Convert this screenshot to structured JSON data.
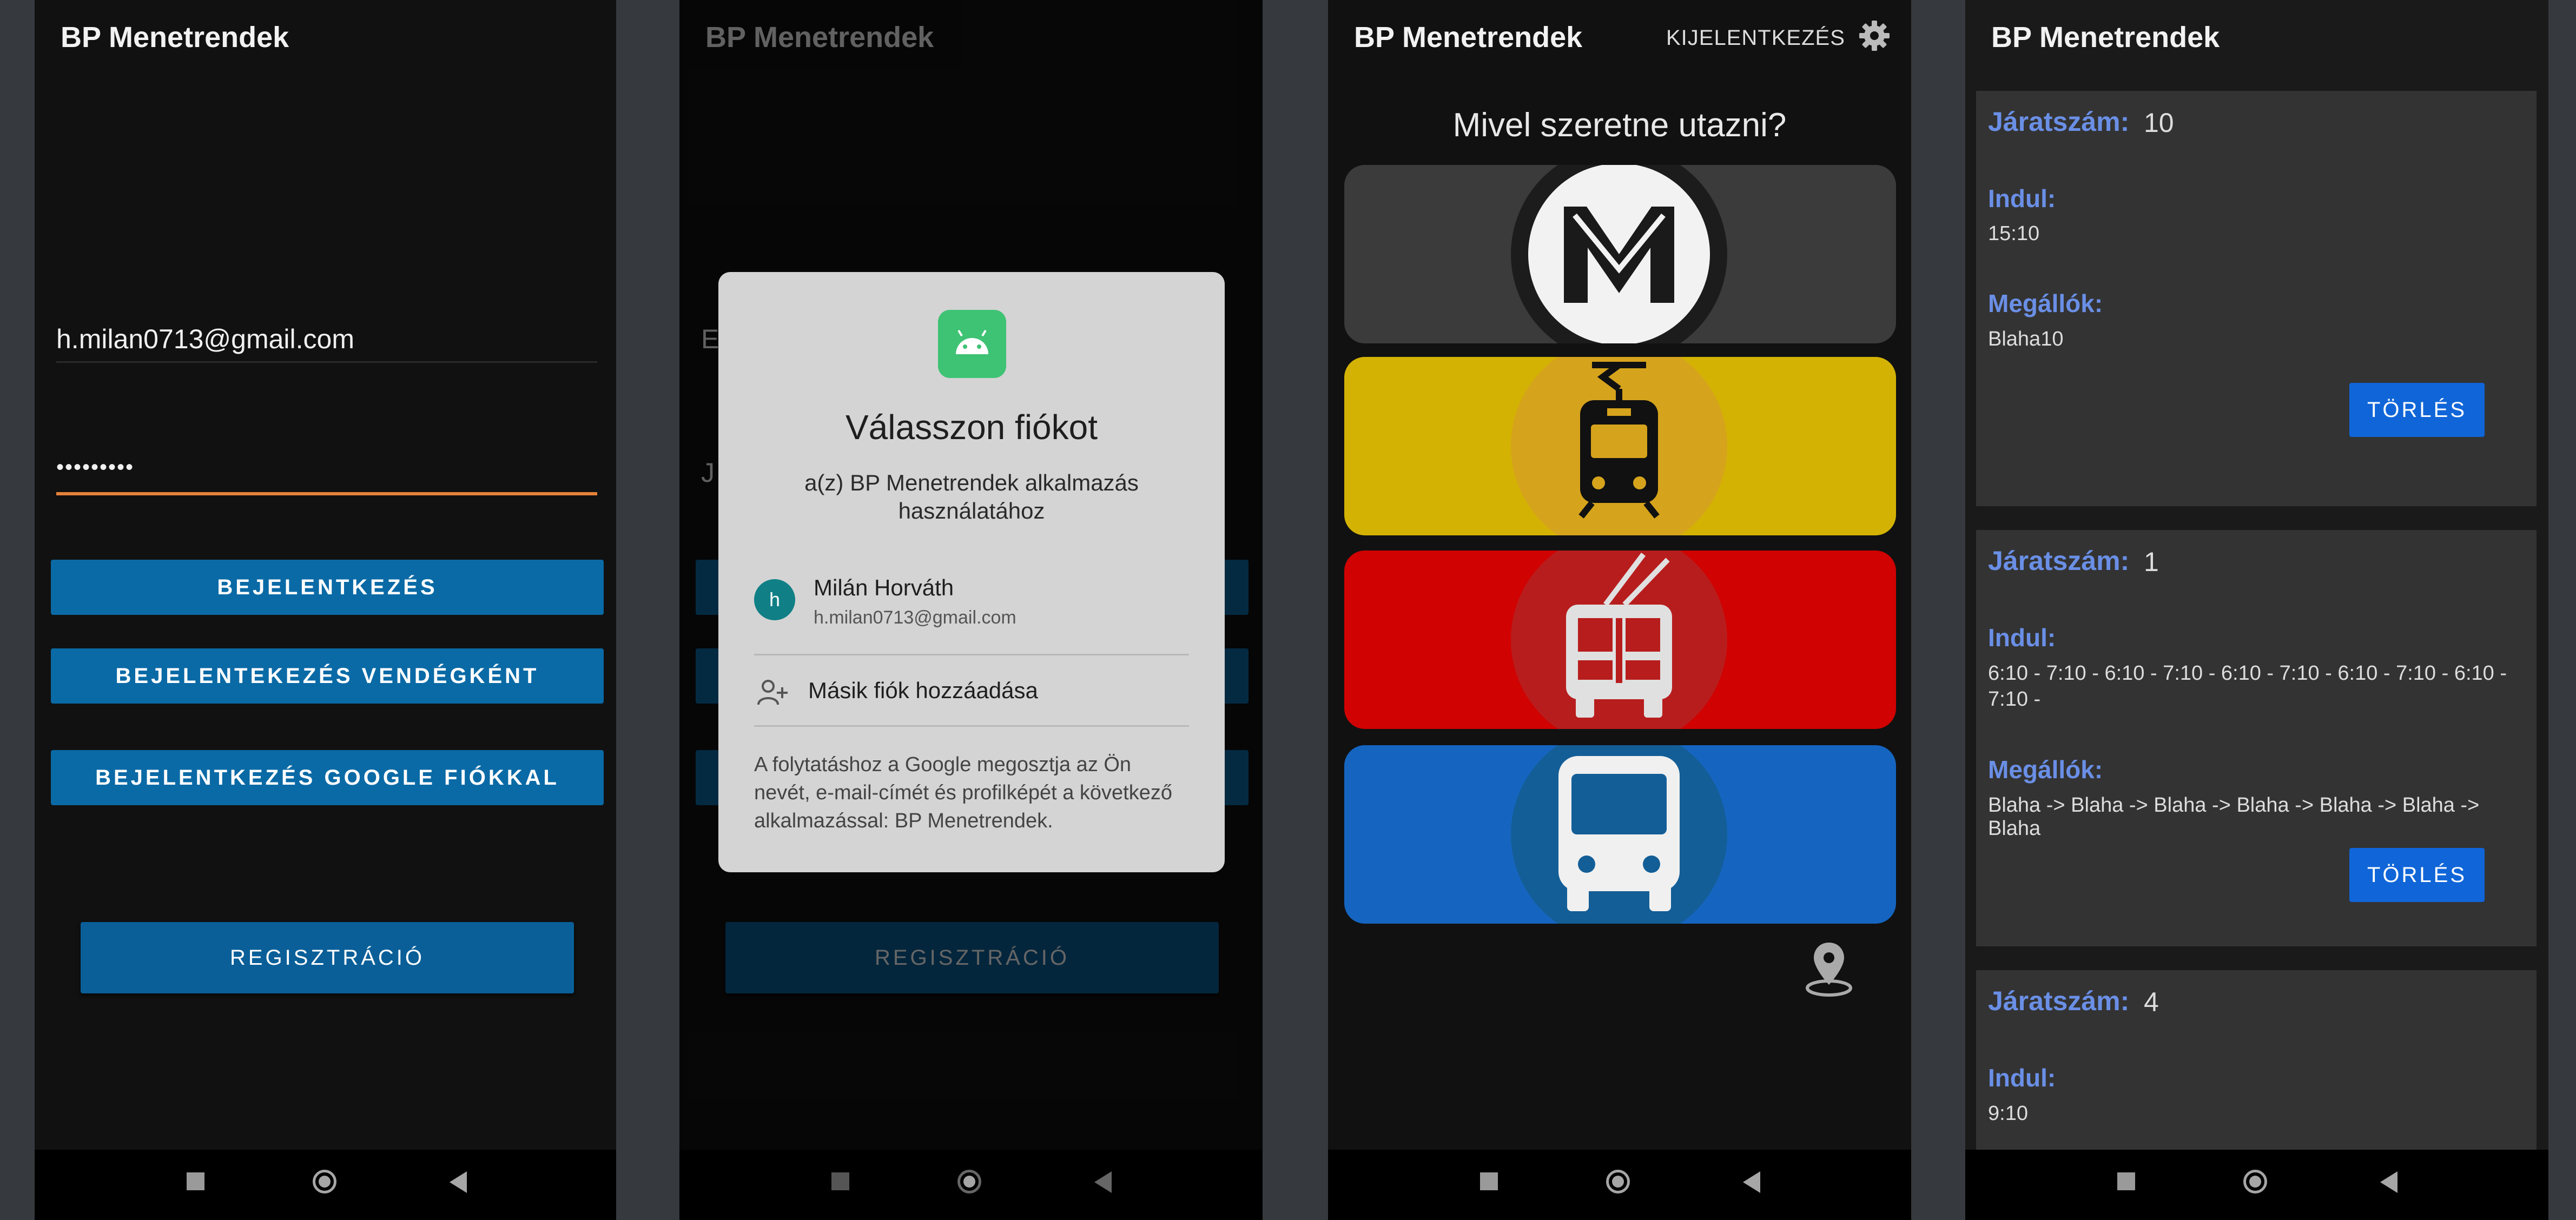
{
  "app_title": "BP Menetrendek",
  "login": {
    "email_value": "h.milan0713@gmail.com",
    "password_value": "•••••••••",
    "login_label": "BEJELENTKEZÉS",
    "guest_label": "BEJELENTEKEZÉS VENDÉGKÉNT",
    "google_label": "BEJELENTKEZÉS GOOGLE FIÓKKAL",
    "register_label": "REGISZTRÁCIÓ"
  },
  "screen2_bg": {
    "email_initial": "E",
    "password_initial": "J"
  },
  "account_dialog": {
    "title": "Válasszon fiókot",
    "subtitle_line1": "a(z) BP Menetrendek alkalmazás",
    "subtitle_line2": "használatához",
    "account_initial": "h",
    "account_name": "Milán Horváth",
    "account_email": "h.milan0713@gmail.com",
    "add_account": "Másik fiók hozzáadása",
    "disclaimer_line1": "A folytatáshoz a Google megosztja az Ön",
    "disclaimer_line2": "nevét, e-mail-címét és profilképét a következő",
    "disclaimer_line3": "alkalmazással: BP Menetrendek."
  },
  "transport": {
    "logout_label": "KIJELENTKEZÉS",
    "question": "Mivel szeretne utazni?",
    "options": [
      "metro-icon",
      "tram-icon",
      "trolleybus-icon",
      "bus-icon"
    ],
    "colors": {
      "metro": "#3b3b3b",
      "tram": "#d4b204",
      "trolley": "#d10202",
      "bus": "#1565c0"
    }
  },
  "routes": {
    "number_label": "Járatszám:",
    "departs_label": "Indul:",
    "stops_label": "Megállók:",
    "delete_label": "TÖRLÉS",
    "items": [
      {
        "number": "10",
        "departs": "15:10",
        "stops": "Blaha10"
      },
      {
        "number": "1",
        "departs_line1": "6:10 - 7:10 - 6:10 - 7:10 - 6:10 - 7:10 - 6:10 - 7:10 - 6:10 -",
        "departs_line2": "7:10 -",
        "stops": "Blaha -> Blaha -> Blaha -> Blaha -> Blaha -> Blaha -> Blaha"
      },
      {
        "number": "4",
        "departs": "9:10"
      }
    ]
  }
}
